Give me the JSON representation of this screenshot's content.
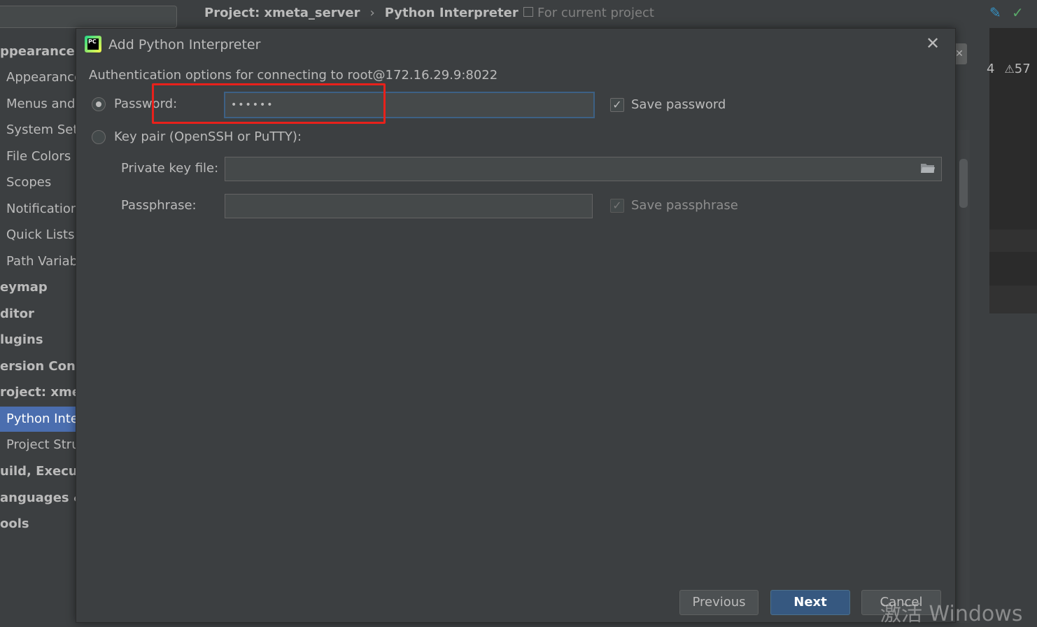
{
  "sidebar": {
    "items": [
      {
        "label": "ppearance &",
        "kind": "top"
      },
      {
        "label": "Appearance",
        "kind": "sub"
      },
      {
        "label": "Menus and",
        "kind": "sub"
      },
      {
        "label": "System Sett",
        "kind": "sub"
      },
      {
        "label": "File Colors",
        "kind": "sub"
      },
      {
        "label": "Scopes",
        "kind": "sub"
      },
      {
        "label": "Notification",
        "kind": "sub"
      },
      {
        "label": "Quick Lists",
        "kind": "sub"
      },
      {
        "label": "Path Variab",
        "kind": "sub"
      },
      {
        "label": "eymap",
        "kind": "top"
      },
      {
        "label": "ditor",
        "kind": "top"
      },
      {
        "label": "lugins",
        "kind": "top"
      },
      {
        "label": "ersion Contr",
        "kind": "top"
      },
      {
        "label": "roject: xmeta",
        "kind": "top"
      },
      {
        "label": "Python Inte",
        "kind": "sub",
        "selected": true
      },
      {
        "label": "Project Stru",
        "kind": "sub"
      },
      {
        "label": "uild, Executi",
        "kind": "top"
      },
      {
        "label": "anguages &",
        "kind": "top"
      },
      {
        "label": "ools",
        "kind": "top"
      }
    ]
  },
  "breadcrumb": {
    "project": "Project: xmeta_server",
    "separator": "›",
    "page": "Python Interpreter"
  },
  "scope_label": "For current project",
  "editor_status": {
    "left_count": "4",
    "warning_count": "57",
    "warning_symbol": "⚠",
    "check_symbol": "✓",
    "pencil_symbol": "✎"
  },
  "dialog": {
    "title": "Add Python Interpreter",
    "logo_text": "PC",
    "close_symbol": "✕",
    "auth_heading": "Authentication options for connecting to root@172.16.29.9:8022",
    "password_option": {
      "label": "Password:",
      "selected": true
    },
    "password_value": "••••••",
    "save_password": {
      "label": "Save password",
      "checked": true
    },
    "keypair_option": {
      "label": "Key pair (OpenSSH or PuTTY):",
      "selected": false
    },
    "private_key_label": "Private key file:",
    "private_key_value": "",
    "passphrase_label": "Passphrase:",
    "passphrase_value": "",
    "save_passphrase": {
      "label": "Save passphrase",
      "checked": true,
      "enabled": false
    },
    "buttons": {
      "previous": "Previous",
      "next": "Next",
      "cancel": "Cancel"
    }
  },
  "highlight_color": "#e8211b",
  "watermark": "激活 Windows"
}
